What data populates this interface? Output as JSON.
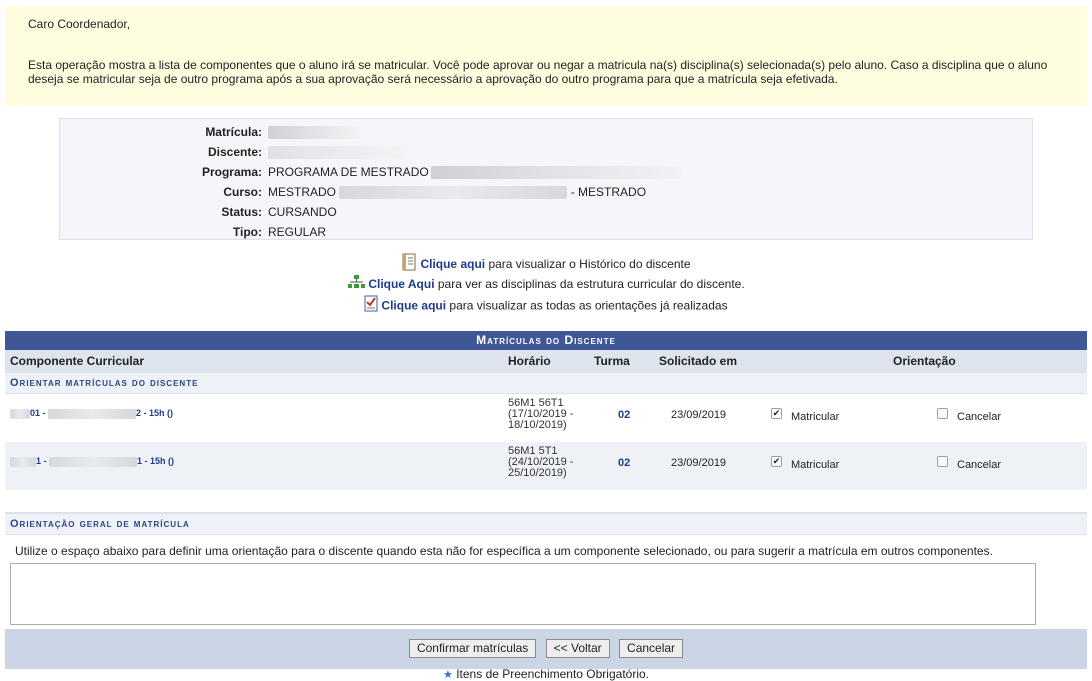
{
  "notice": {
    "greeting": "Caro Coordenador,",
    "text": "Esta operação mostra a lista de componentes que o aluno irá se matricular. Você pode aprovar ou negar a matricula na(s) disciplina(s) selecionada(s) pelo aluno. Caso a disciplina que o aluno deseja se matricular seja de outro programa após a sua aprovação será necessário a aprovação do outro programa para que a matrícula seja efetivada."
  },
  "info": {
    "matricula_label": "Matrícula:",
    "discente_label": "Discente:",
    "programa_label": "Programa:",
    "programa_value": "PROGRAMA DE MESTRADO",
    "curso_label": "Curso:",
    "curso_prefix": "MESTRADO",
    "curso_suffix": "- MESTRADO",
    "status_label": "Status:",
    "status_value": "CURSANDO",
    "tipo_label": "Tipo:",
    "tipo_value": "REGULAR"
  },
  "links": {
    "historico_link": "Clique aqui",
    "historico_text": " para visualizar o Histórico do discente",
    "estrutura_link": "Clique Aqui",
    "estrutura_text": " para ver as disciplinas da estrutura curricular do discente.",
    "orientacoes_link": "Clique aqui",
    "orientacoes_text": " para visualizar as todas as orientações já realizadas"
  },
  "table": {
    "caption": "Matrículas do Discente",
    "headers": {
      "componente": "Componente Curricular",
      "horario": "Horário",
      "turma": "Turma",
      "solicitado": "Solicitado em",
      "orientacao": "Orientação"
    },
    "section_orientar": "Orientar matrículas do discente",
    "rows": [
      {
        "comp_a": "01 -",
        "comp_b": "2 - 15h ()",
        "horario_1": "56M1 56T1",
        "horario_2": "(17/10/2019 -",
        "horario_3": "18/10/2019)",
        "turma": "02",
        "solicitado": "23/09/2019",
        "matricular_label": "Matricular",
        "matricular_checked": true,
        "cancelar_label": "Cancelar",
        "cancelar_checked": false
      },
      {
        "comp_a": "1 -",
        "comp_b": "1 - 15h ()",
        "horario_1": "56M1 5T1",
        "horario_2": "(24/10/2019 -",
        "horario_3": "25/10/2019)",
        "turma": "02",
        "solicitado": "23/09/2019",
        "matricular_label": "Matricular",
        "matricular_checked": true,
        "cancelar_label": "Cancelar",
        "cancelar_checked": false
      }
    ],
    "section_geral": "Orientação geral de matrícula",
    "geral_text": "Utilize o espaço abaixo para definir uma orientação para o discente quando esta não for específica a um componente selecionado, ou para sugerir a matrícula em outros componentes."
  },
  "buttons": {
    "confirmar": "Confirmar matrículas",
    "voltar": "<< Voltar",
    "cancelar": "Cancelar"
  },
  "footer": {
    "text": "Itens de Preenchimento Obrigatório."
  },
  "colors": {
    "notice_bg": "#fefde0",
    "caption_bg": "#3f5796",
    "link": "#1f3c8a"
  }
}
